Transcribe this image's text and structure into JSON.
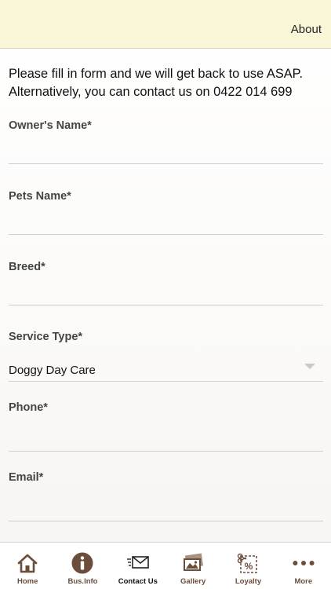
{
  "header": {
    "about_label": "About"
  },
  "intro": {
    "line1": "Please fill in form and we will get back to use ASAP.",
    "line2": "Alternatively, you can contact us on 0422 014 699"
  },
  "form": {
    "owners_name": {
      "label": "Owner's Name*",
      "value": "",
      "placeholder": ""
    },
    "pets_name": {
      "label": "Pets Name*",
      "value": "",
      "placeholder": ""
    },
    "breed": {
      "label": "Breed*",
      "value": "",
      "placeholder": ""
    },
    "service_type": {
      "label": "Service Type*",
      "selected": "Doggy Day Care"
    },
    "phone": {
      "label": "Phone*",
      "value": "",
      "placeholder": ""
    },
    "email": {
      "label": "Email*",
      "value": "",
      "placeholder": ""
    }
  },
  "tabs": [
    {
      "label": "Home",
      "icon": "home-icon"
    },
    {
      "label": "Bus.Info",
      "icon": "info-icon"
    },
    {
      "label": "Contact Us",
      "icon": "mail-icon"
    },
    {
      "label": "Gallery",
      "icon": "gallery-icon"
    },
    {
      "label": "Loyalty",
      "icon": "coupon-icon"
    },
    {
      "label": "More",
      "icon": "more-icon"
    }
  ],
  "colors": {
    "header_bg": "#faf6d8",
    "icon_brown": "#6b4d3a",
    "active_tab_label": "#111111"
  }
}
